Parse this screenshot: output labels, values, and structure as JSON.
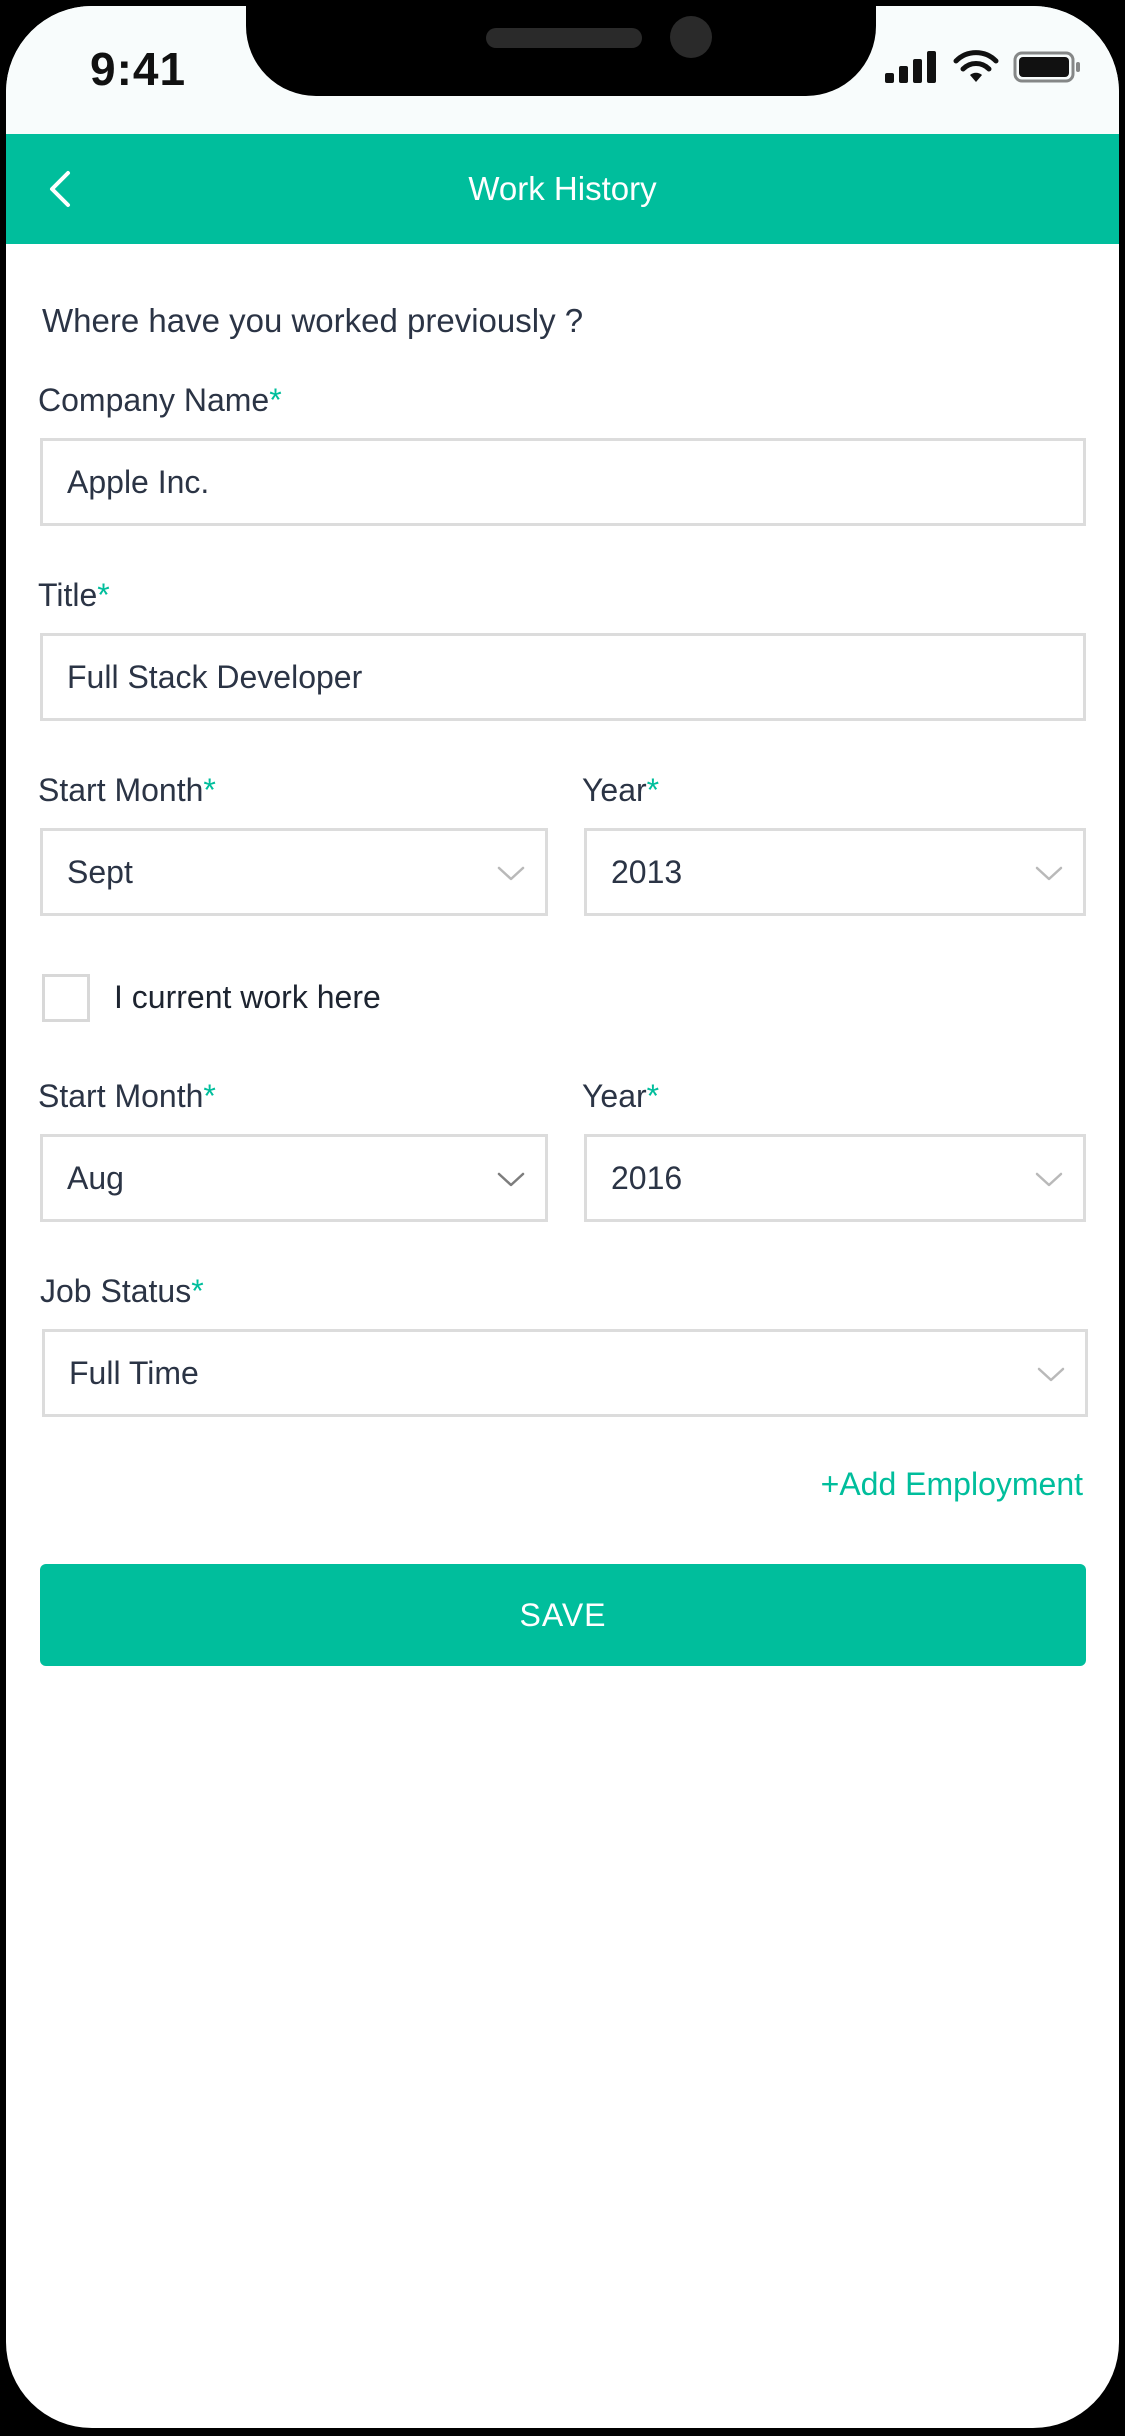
{
  "status_bar": {
    "time": "9:41"
  },
  "nav": {
    "title": "Work History"
  },
  "form": {
    "question": "Where have you worked previously ?",
    "required_mark": "*",
    "company": {
      "label": "Company Name",
      "value": "Apple Inc."
    },
    "title": {
      "label": "Title",
      "value": "Full Stack Developer"
    },
    "start_month_1": {
      "label": "Start Month",
      "value": "Sept"
    },
    "start_year_1": {
      "label": "Year",
      "value": "2013"
    },
    "current_work": {
      "label": "I current work here",
      "checked": false
    },
    "start_month_2": {
      "label": "Start Month",
      "value": "Aug"
    },
    "start_year_2": {
      "label": "Year",
      "value": "2016"
    },
    "job_status": {
      "label": "Job Status",
      "value": "Full Time"
    },
    "add_employment": "+Add Employment",
    "save": "SAVE"
  },
  "colors": {
    "accent": "#00be9c",
    "text": "#2b3445",
    "border": "#dcdcdc"
  },
  "icons": {
    "back": "chevron-left-icon",
    "dropdown": "chevron-down-icon",
    "signal": "cellular-signal-icon",
    "wifi": "wifi-icon",
    "battery": "battery-icon"
  }
}
